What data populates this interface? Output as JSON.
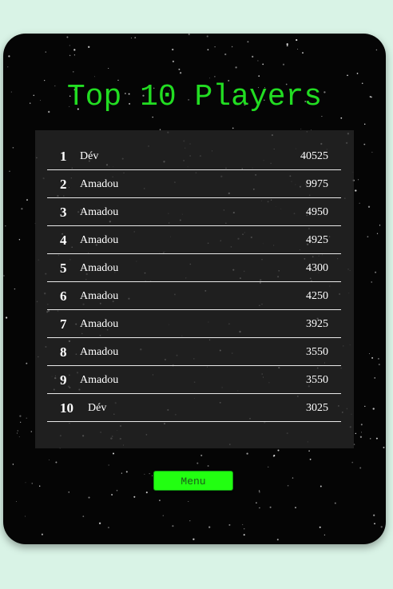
{
  "title": "Top 10 Players",
  "leaderboard": [
    {
      "rank": "1",
      "name": "Dév",
      "score": "40525"
    },
    {
      "rank": "2",
      "name": "Amadou",
      "score": "9975"
    },
    {
      "rank": "3",
      "name": "Amadou",
      "score": "4950"
    },
    {
      "rank": "4",
      "name": "Amadou",
      "score": "4925"
    },
    {
      "rank": "5",
      "name": "Amadou",
      "score": "4300"
    },
    {
      "rank": "6",
      "name": "Amadou",
      "score": "4250"
    },
    {
      "rank": "7",
      "name": "Amadou",
      "score": "3925"
    },
    {
      "rank": "8",
      "name": "Amadou",
      "score": "3550"
    },
    {
      "rank": "9",
      "name": "Amadou",
      "score": "3550"
    },
    {
      "rank": "10",
      "name": "Dév",
      "score": "3025"
    }
  ],
  "menu_button": {
    "label": "Menu"
  },
  "colors": {
    "accent": "#22dd22",
    "button": "#22ff11",
    "background": "#d9f3e6",
    "panel": "#050505"
  }
}
